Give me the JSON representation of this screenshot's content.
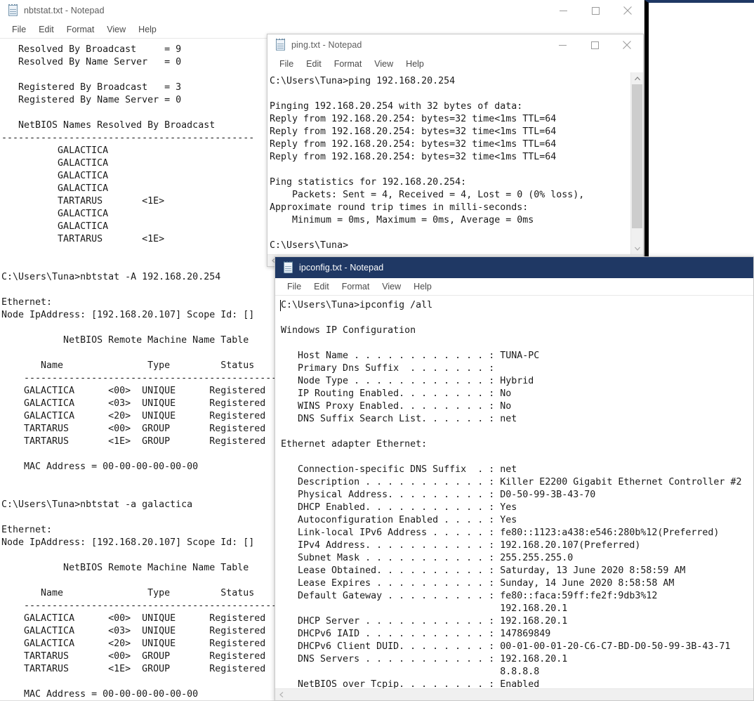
{
  "windows": {
    "nbtstat": {
      "title": "nbtstat.txt - Notepad",
      "icon": "notepad-icon",
      "state": "inactive",
      "menu": [
        "File",
        "Edit",
        "Format",
        "View",
        "Help"
      ],
      "controls": {
        "minimize": "minimize-button",
        "maximize": "maximize-button",
        "close": "close-button"
      },
      "content": "   Resolved By Broadcast     = 9\n   Resolved By Name Server   = 0\n\n   Registered By Broadcast   = 3\n   Registered By Name Server = 0\n\n   NetBIOS Names Resolved By Broadcast\n---------------------------------------------\n          GALACTICA\n          GALACTICA\n          GALACTICA\n          GALACTICA\n          TARTARUS       <1E>\n          GALACTICA\n          GALACTICA\n          TARTARUS       <1E>\n\n\nC:\\Users\\Tuna>nbtstat -A 192.168.20.254\n\nEthernet:\nNode IpAddress: [192.168.20.107] Scope Id: []\n\n           NetBIOS Remote Machine Name Table\n\n       Name               Type         Status\n    ---------------------------------------------\n    GALACTICA      <00>  UNIQUE      Registered\n    GALACTICA      <03>  UNIQUE      Registered\n    GALACTICA      <20>  UNIQUE      Registered\n    TARTARUS       <00>  GROUP       Registered\n    TARTARUS       <1E>  GROUP       Registered\n\n    MAC Address = 00-00-00-00-00-00\n\n\nC:\\Users\\Tuna>nbtstat -a galactica\n\nEthernet:\nNode IpAddress: [192.168.20.107] Scope Id: []\n\n           NetBIOS Remote Machine Name Table\n\n       Name               Type         Status\n    ---------------------------------------------\n    GALACTICA      <00>  UNIQUE      Registered\n    GALACTICA      <03>  UNIQUE      Registered\n    GALACTICA      <20>  UNIQUE      Registered\n    TARTARUS       <00>  GROUP       Registered\n    TARTARUS       <1E>  GROUP       Registered\n\n    MAC Address = 00-00-00-00-00-00"
    },
    "ping": {
      "title": "ping.txt - Notepad",
      "icon": "notepad-icon",
      "state": "inactive",
      "menu": [
        "File",
        "Edit",
        "Format",
        "View",
        "Help"
      ],
      "controls": {
        "minimize": "minimize-button",
        "maximize": "maximize-button",
        "close": "close-button"
      },
      "content": "C:\\Users\\Tuna>ping 192.168.20.254\n\nPinging 192.168.20.254 with 32 bytes of data:\nReply from 192.168.20.254: bytes=32 time<1ms TTL=64\nReply from 192.168.20.254: bytes=32 time<1ms TTL=64\nReply from 192.168.20.254: bytes=32 time<1ms TTL=64\nReply from 192.168.20.254: bytes=32 time<1ms TTL=64\n\nPing statistics for 192.168.20.254:\n    Packets: Sent = 4, Received = 4, Lost = 0 (0% loss),\nApproximate round trip times in milli-seconds:\n    Minimum = 0ms, Maximum = 0ms, Average = 0ms\n\nC:\\Users\\Tuna>"
    },
    "ipconfig": {
      "title": "ipconfig.txt - Notepad",
      "icon": "notepad-icon",
      "state": "active",
      "menu": [
        "File",
        "Edit",
        "Format",
        "View",
        "Help"
      ],
      "content": "C:\\Users\\Tuna>ipconfig /all\n\nWindows IP Configuration\n\n   Host Name . . . . . . . . . . . . : TUNA-PC\n   Primary Dns Suffix  . . . . . . . :\n   Node Type . . . . . . . . . . . . : Hybrid\n   IP Routing Enabled. . . . . . . . : No\n   WINS Proxy Enabled. . . . . . . . : No\n   DNS Suffix Search List. . . . . . : net\n\nEthernet adapter Ethernet:\n\n   Connection-specific DNS Suffix  . : net\n   Description . . . . . . . . . . . : Killer E2200 Gigabit Ethernet Controller #2\n   Physical Address. . . . . . . . . : D0-50-99-3B-43-70\n   DHCP Enabled. . . . . . . . . . . : Yes\n   Autoconfiguration Enabled . . . . : Yes\n   Link-local IPv6 Address . . . . . : fe80::1123:a438:e546:280b%12(Preferred)\n   IPv4 Address. . . . . . . . . . . : 192.168.20.107(Preferred)\n   Subnet Mask . . . . . . . . . . . : 255.255.255.0\n   Lease Obtained. . . . . . . . . . : Saturday, 13 June 2020 8:58:59 AM\n   Lease Expires . . . . . . . . . . : Sunday, 14 June 2020 8:58:58 AM\n   Default Gateway . . . . . . . . . : fe80::faca:59ff:fe2f:9db3%12\n                                       192.168.20.1\n   DHCP Server . . . . . . . . . . . : 192.168.20.1\n   DHCPv6 IAID . . . . . . . . . . . : 147869849\n   DHCPv6 Client DUID. . . . . . . . : 00-01-00-01-20-C6-C7-BD-D0-50-99-3B-43-71\n   DNS Servers . . . . . . . . . . . : 192.168.20.1\n                                       8.8.8.8\n   NetBIOS over Tcpip. . . . . . . . : Enabled"
    }
  },
  "colors": {
    "active_titlebar": "#1f3864",
    "inactive_titlebar": "#ffffff",
    "text": "#1a1a1a",
    "menu_text": "#4a4a4a",
    "scrollbar_thumb": "#cdcdcd"
  },
  "icons": {
    "minimize": "minimize-icon",
    "maximize": "maximize-icon",
    "close": "close-icon",
    "scroll_up": "scroll-up-arrow-icon",
    "scroll_down": "scroll-down-arrow-icon",
    "scroll_left": "scroll-left-arrow-icon",
    "scroll_right": "scroll-right-arrow-icon"
  }
}
